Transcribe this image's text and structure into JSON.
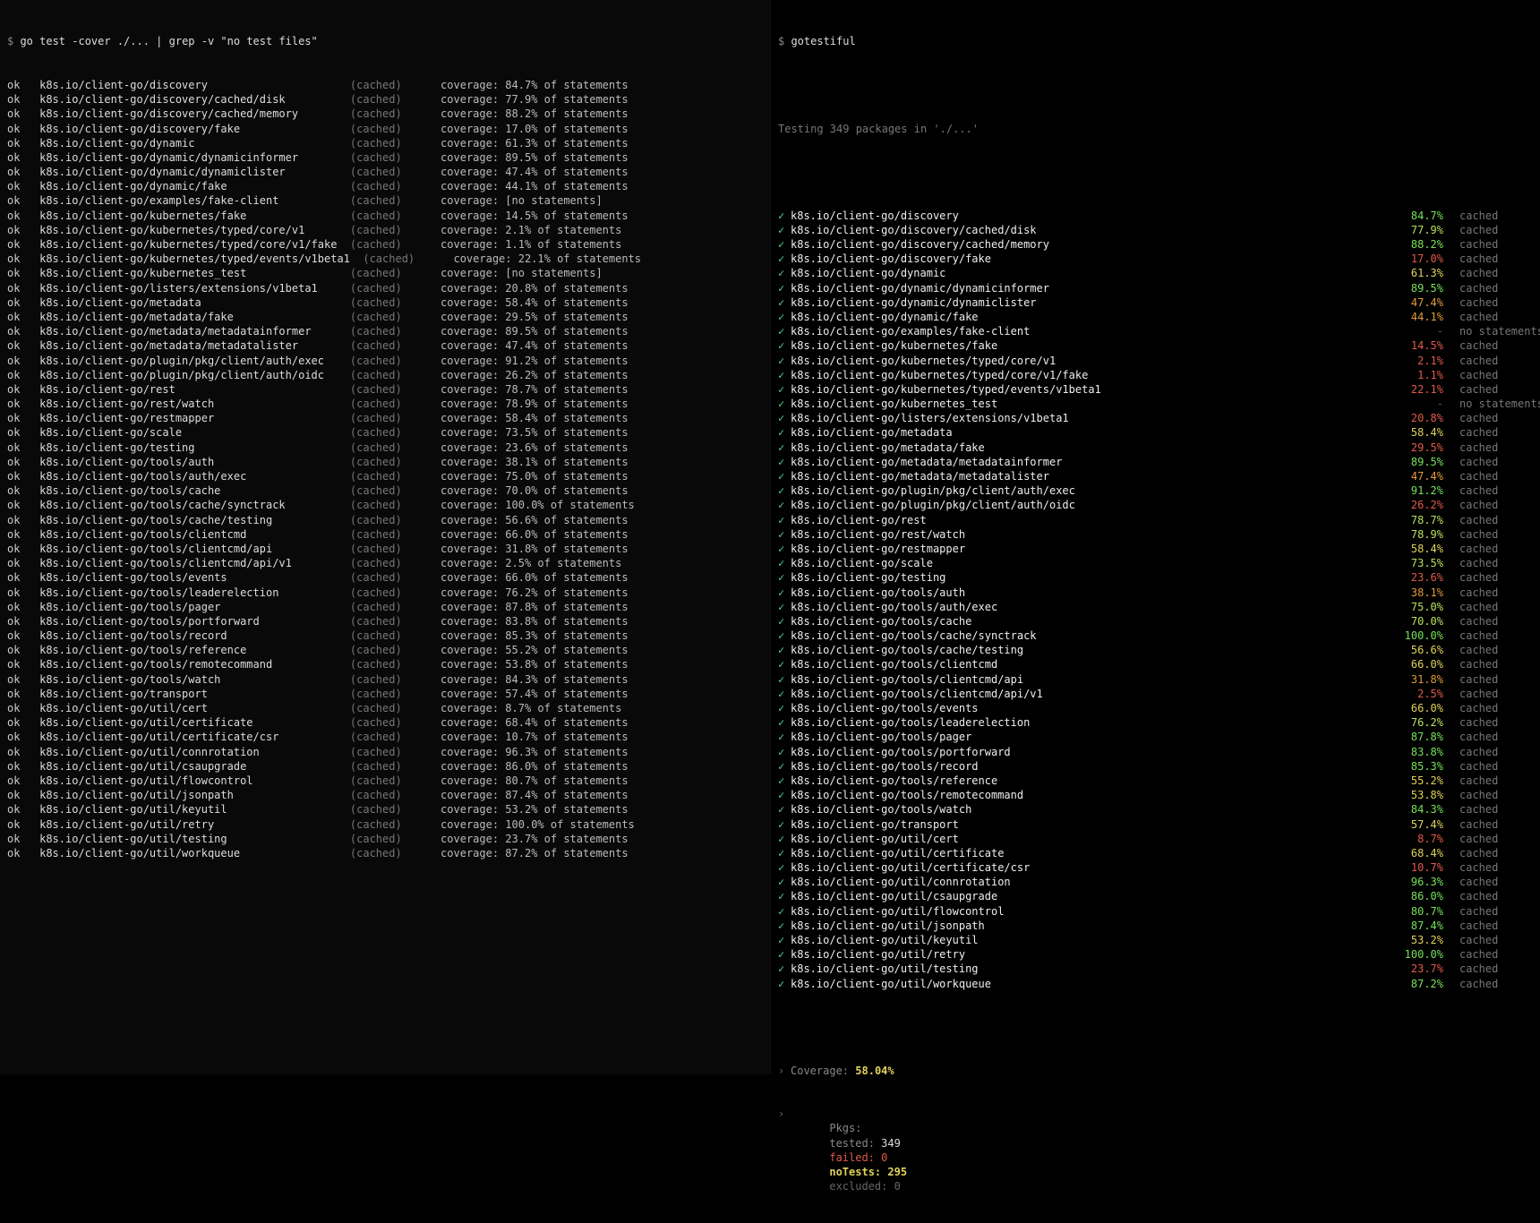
{
  "left": {
    "prompt": "$ ",
    "command": "go test -cover ./... | grep -v \"no test files\"",
    "rows": [
      {
        "pkg": "k8s.io/client-go/discovery",
        "cached": true,
        "cov": "84.7% of statements"
      },
      {
        "pkg": "k8s.io/client-go/discovery/cached/disk",
        "cached": true,
        "cov": "77.9% of statements"
      },
      {
        "pkg": "k8s.io/client-go/discovery/cached/memory",
        "cached": true,
        "cov": "88.2% of statements"
      },
      {
        "pkg": "k8s.io/client-go/discovery/fake",
        "cached": true,
        "cov": "17.0% of statements"
      },
      {
        "pkg": "k8s.io/client-go/dynamic",
        "cached": true,
        "cov": "61.3% of statements"
      },
      {
        "pkg": "k8s.io/client-go/dynamic/dynamicinformer",
        "cached": true,
        "cov": "89.5% of statements"
      },
      {
        "pkg": "k8s.io/client-go/dynamic/dynamiclister",
        "cached": true,
        "cov": "47.4% of statements"
      },
      {
        "pkg": "k8s.io/client-go/dynamic/fake",
        "cached": true,
        "cov": "44.1% of statements"
      },
      {
        "pkg": "k8s.io/client-go/examples/fake-client",
        "cached": true,
        "cov": "[no statements]"
      },
      {
        "pkg": "k8s.io/client-go/kubernetes/fake",
        "cached": true,
        "cov": "14.5% of statements"
      },
      {
        "pkg": "k8s.io/client-go/kubernetes/typed/core/v1",
        "cached": true,
        "cov": "2.1% of statements"
      },
      {
        "pkg": "k8s.io/client-go/kubernetes/typed/core/v1/fake",
        "cached": true,
        "cov": "1.1% of statements"
      },
      {
        "pkg": "k8s.io/client-go/kubernetes/typed/events/v1beta1",
        "cached": true,
        "cov": "22.1% of statements"
      },
      {
        "pkg": "k8s.io/client-go/kubernetes_test",
        "cached": true,
        "cov": "[no statements]"
      },
      {
        "pkg": "k8s.io/client-go/listers/extensions/v1beta1",
        "cached": true,
        "cov": "20.8% of statements"
      },
      {
        "pkg": "k8s.io/client-go/metadata",
        "cached": true,
        "cov": "58.4% of statements"
      },
      {
        "pkg": "k8s.io/client-go/metadata/fake",
        "cached": true,
        "cov": "29.5% of statements"
      },
      {
        "pkg": "k8s.io/client-go/metadata/metadatainformer",
        "cached": true,
        "cov": "89.5% of statements"
      },
      {
        "pkg": "k8s.io/client-go/metadata/metadatalister",
        "cached": true,
        "cov": "47.4% of statements"
      },
      {
        "pkg": "k8s.io/client-go/plugin/pkg/client/auth/exec",
        "cached": true,
        "cov": "91.2% of statements"
      },
      {
        "pkg": "k8s.io/client-go/plugin/pkg/client/auth/oidc",
        "cached": true,
        "cov": "26.2% of statements"
      },
      {
        "pkg": "k8s.io/client-go/rest",
        "cached": true,
        "cov": "78.7% of statements"
      },
      {
        "pkg": "k8s.io/client-go/rest/watch",
        "cached": true,
        "cov": "78.9% of statements"
      },
      {
        "pkg": "k8s.io/client-go/restmapper",
        "cached": true,
        "cov": "58.4% of statements"
      },
      {
        "pkg": "k8s.io/client-go/scale",
        "cached": true,
        "cov": "73.5% of statements"
      },
      {
        "pkg": "k8s.io/client-go/testing",
        "cached": true,
        "cov": "23.6% of statements"
      },
      {
        "pkg": "k8s.io/client-go/tools/auth",
        "cached": true,
        "cov": "38.1% of statements"
      },
      {
        "pkg": "k8s.io/client-go/tools/auth/exec",
        "cached": true,
        "cov": "75.0% of statements"
      },
      {
        "pkg": "k8s.io/client-go/tools/cache",
        "cached": true,
        "cov": "70.0% of statements"
      },
      {
        "pkg": "k8s.io/client-go/tools/cache/synctrack",
        "cached": true,
        "cov": "100.0% of statements"
      },
      {
        "pkg": "k8s.io/client-go/tools/cache/testing",
        "cached": true,
        "cov": "56.6% of statements"
      },
      {
        "pkg": "k8s.io/client-go/tools/clientcmd",
        "cached": true,
        "cov": "66.0% of statements"
      },
      {
        "pkg": "k8s.io/client-go/tools/clientcmd/api",
        "cached": true,
        "cov": "31.8% of statements"
      },
      {
        "pkg": "k8s.io/client-go/tools/clientcmd/api/v1",
        "cached": true,
        "cov": "2.5% of statements"
      },
      {
        "pkg": "k8s.io/client-go/tools/events",
        "cached": true,
        "cov": "66.0% of statements"
      },
      {
        "pkg": "k8s.io/client-go/tools/leaderelection",
        "cached": true,
        "cov": "76.2% of statements"
      },
      {
        "pkg": "k8s.io/client-go/tools/pager",
        "cached": true,
        "cov": "87.8% of statements"
      },
      {
        "pkg": "k8s.io/client-go/tools/portforward",
        "cached": true,
        "cov": "83.8% of statements"
      },
      {
        "pkg": "k8s.io/client-go/tools/record",
        "cached": true,
        "cov": "85.3% of statements"
      },
      {
        "pkg": "k8s.io/client-go/tools/reference",
        "cached": true,
        "cov": "55.2% of statements"
      },
      {
        "pkg": "k8s.io/client-go/tools/remotecommand",
        "cached": true,
        "cov": "53.8% of statements"
      },
      {
        "pkg": "k8s.io/client-go/tools/watch",
        "cached": true,
        "cov": "84.3% of statements"
      },
      {
        "pkg": "k8s.io/client-go/transport",
        "cached": true,
        "cov": "57.4% of statements"
      },
      {
        "pkg": "k8s.io/client-go/util/cert",
        "cached": true,
        "cov": "8.7% of statements"
      },
      {
        "pkg": "k8s.io/client-go/util/certificate",
        "cached": true,
        "cov": "68.4% of statements"
      },
      {
        "pkg": "k8s.io/client-go/util/certificate/csr",
        "cached": true,
        "cov": "10.7% of statements"
      },
      {
        "pkg": "k8s.io/client-go/util/connrotation",
        "cached": true,
        "cov": "96.3% of statements"
      },
      {
        "pkg": "k8s.io/client-go/util/csaupgrade",
        "cached": true,
        "cov": "86.0% of statements"
      },
      {
        "pkg": "k8s.io/client-go/util/flowcontrol",
        "cached": true,
        "cov": "80.7% of statements"
      },
      {
        "pkg": "k8s.io/client-go/util/jsonpath",
        "cached": true,
        "cov": "87.4% of statements"
      },
      {
        "pkg": "k8s.io/client-go/util/keyutil",
        "cached": true,
        "cov": "53.2% of statements"
      },
      {
        "pkg": "k8s.io/client-go/util/retry",
        "cached": true,
        "cov": "100.0% of statements"
      },
      {
        "pkg": "k8s.io/client-go/util/testing",
        "cached": true,
        "cov": "23.7% of statements"
      },
      {
        "pkg": "k8s.io/client-go/util/workqueue",
        "cached": true,
        "cov": "87.2% of statements"
      }
    ]
  },
  "right": {
    "prompt": "$ ",
    "command": "gotestiful",
    "subtitle": "Testing 349 packages in './...'",
    "rows": [
      {
        "pkg": "k8s.io/client-go/discovery",
        "cov": "84.7%",
        "class": "c-green",
        "status": "cached"
      },
      {
        "pkg": "k8s.io/client-go/discovery/cached/disk",
        "cov": "77.9%",
        "class": "c-lime",
        "status": "cached"
      },
      {
        "pkg": "k8s.io/client-go/discovery/cached/memory",
        "cov": "88.2%",
        "class": "c-green",
        "status": "cached"
      },
      {
        "pkg": "k8s.io/client-go/discovery/fake",
        "cov": "17.0%",
        "class": "c-red",
        "status": "cached"
      },
      {
        "pkg": "k8s.io/client-go/dynamic",
        "cov": "61.3%",
        "class": "c-yellow",
        "status": "cached"
      },
      {
        "pkg": "k8s.io/client-go/dynamic/dynamicinformer",
        "cov": "89.5%",
        "class": "c-green",
        "status": "cached"
      },
      {
        "pkg": "k8s.io/client-go/dynamic/dynamiclister",
        "cov": "47.4%",
        "class": "c-orange",
        "status": "cached"
      },
      {
        "pkg": "k8s.io/client-go/dynamic/fake",
        "cov": "44.1%",
        "class": "c-orange",
        "status": "cached"
      },
      {
        "pkg": "k8s.io/client-go/examples/fake-client",
        "cov": "-",
        "class": "c-dash",
        "status": "no statements"
      },
      {
        "pkg": "k8s.io/client-go/kubernetes/fake",
        "cov": "14.5%",
        "class": "c-red",
        "status": "cached"
      },
      {
        "pkg": "k8s.io/client-go/kubernetes/typed/core/v1",
        "cov": "2.1%",
        "class": "c-red",
        "status": "cached"
      },
      {
        "pkg": "k8s.io/client-go/kubernetes/typed/core/v1/fake",
        "cov": "1.1%",
        "class": "c-red",
        "status": "cached"
      },
      {
        "pkg": "k8s.io/client-go/kubernetes/typed/events/v1beta1",
        "cov": "22.1%",
        "class": "c-red",
        "status": "cached"
      },
      {
        "pkg": "k8s.io/client-go/kubernetes_test",
        "cov": "-",
        "class": "c-dash",
        "status": "no statements"
      },
      {
        "pkg": "k8s.io/client-go/listers/extensions/v1beta1",
        "cov": "20.8%",
        "class": "c-red",
        "status": "cached"
      },
      {
        "pkg": "k8s.io/client-go/metadata",
        "cov": "58.4%",
        "class": "c-yellow",
        "status": "cached"
      },
      {
        "pkg": "k8s.io/client-go/metadata/fake",
        "cov": "29.5%",
        "class": "c-red",
        "status": "cached"
      },
      {
        "pkg": "k8s.io/client-go/metadata/metadatainformer",
        "cov": "89.5%",
        "class": "c-green",
        "status": "cached"
      },
      {
        "pkg": "k8s.io/client-go/metadata/metadatalister",
        "cov": "47.4%",
        "class": "c-orange",
        "status": "cached"
      },
      {
        "pkg": "k8s.io/client-go/plugin/pkg/client/auth/exec",
        "cov": "91.2%",
        "class": "c-green",
        "status": "cached"
      },
      {
        "pkg": "k8s.io/client-go/plugin/pkg/client/auth/oidc",
        "cov": "26.2%",
        "class": "c-red",
        "status": "cached"
      },
      {
        "pkg": "k8s.io/client-go/rest",
        "cov": "78.7%",
        "class": "c-lime",
        "status": "cached"
      },
      {
        "pkg": "k8s.io/client-go/rest/watch",
        "cov": "78.9%",
        "class": "c-lime",
        "status": "cached"
      },
      {
        "pkg": "k8s.io/client-go/restmapper",
        "cov": "58.4%",
        "class": "c-yellow",
        "status": "cached"
      },
      {
        "pkg": "k8s.io/client-go/scale",
        "cov": "73.5%",
        "class": "c-lime",
        "status": "cached"
      },
      {
        "pkg": "k8s.io/client-go/testing",
        "cov": "23.6%",
        "class": "c-red",
        "status": "cached"
      },
      {
        "pkg": "k8s.io/client-go/tools/auth",
        "cov": "38.1%",
        "class": "c-orange",
        "status": "cached"
      },
      {
        "pkg": "k8s.io/client-go/tools/auth/exec",
        "cov": "75.0%",
        "class": "c-lime",
        "status": "cached"
      },
      {
        "pkg": "k8s.io/client-go/tools/cache",
        "cov": "70.0%",
        "class": "c-lime",
        "status": "cached"
      },
      {
        "pkg": "k8s.io/client-go/tools/cache/synctrack",
        "cov": "100.0%",
        "class": "c-green",
        "status": "cached"
      },
      {
        "pkg": "k8s.io/client-go/tools/cache/testing",
        "cov": "56.6%",
        "class": "c-yellow",
        "status": "cached"
      },
      {
        "pkg": "k8s.io/client-go/tools/clientcmd",
        "cov": "66.0%",
        "class": "c-yellow",
        "status": "cached"
      },
      {
        "pkg": "k8s.io/client-go/tools/clientcmd/api",
        "cov": "31.8%",
        "class": "c-orange",
        "status": "cached"
      },
      {
        "pkg": "k8s.io/client-go/tools/clientcmd/api/v1",
        "cov": "2.5%",
        "class": "c-red",
        "status": "cached"
      },
      {
        "pkg": "k8s.io/client-go/tools/events",
        "cov": "66.0%",
        "class": "c-yellow",
        "status": "cached"
      },
      {
        "pkg": "k8s.io/client-go/tools/leaderelection",
        "cov": "76.2%",
        "class": "c-lime",
        "status": "cached"
      },
      {
        "pkg": "k8s.io/client-go/tools/pager",
        "cov": "87.8%",
        "class": "c-green",
        "status": "cached"
      },
      {
        "pkg": "k8s.io/client-go/tools/portforward",
        "cov": "83.8%",
        "class": "c-green",
        "status": "cached"
      },
      {
        "pkg": "k8s.io/client-go/tools/record",
        "cov": "85.3%",
        "class": "c-green",
        "status": "cached"
      },
      {
        "pkg": "k8s.io/client-go/tools/reference",
        "cov": "55.2%",
        "class": "c-yellow",
        "status": "cached"
      },
      {
        "pkg": "k8s.io/client-go/tools/remotecommand",
        "cov": "53.8%",
        "class": "c-yellow",
        "status": "cached"
      },
      {
        "pkg": "k8s.io/client-go/tools/watch",
        "cov": "84.3%",
        "class": "c-green",
        "status": "cached"
      },
      {
        "pkg": "k8s.io/client-go/transport",
        "cov": "57.4%",
        "class": "c-yellow",
        "status": "cached"
      },
      {
        "pkg": "k8s.io/client-go/util/cert",
        "cov": "8.7%",
        "class": "c-red",
        "status": "cached"
      },
      {
        "pkg": "k8s.io/client-go/util/certificate",
        "cov": "68.4%",
        "class": "c-yellow",
        "status": "cached"
      },
      {
        "pkg": "k8s.io/client-go/util/certificate/csr",
        "cov": "10.7%",
        "class": "c-red",
        "status": "cached"
      },
      {
        "pkg": "k8s.io/client-go/util/connrotation",
        "cov": "96.3%",
        "class": "c-green",
        "status": "cached"
      },
      {
        "pkg": "k8s.io/client-go/util/csaupgrade",
        "cov": "86.0%",
        "class": "c-green",
        "status": "cached"
      },
      {
        "pkg": "k8s.io/client-go/util/flowcontrol",
        "cov": "80.7%",
        "class": "c-green",
        "status": "cached"
      },
      {
        "pkg": "k8s.io/client-go/util/jsonpath",
        "cov": "87.4%",
        "class": "c-green",
        "status": "cached"
      },
      {
        "pkg": "k8s.io/client-go/util/keyutil",
        "cov": "53.2%",
        "class": "c-yellow",
        "status": "cached"
      },
      {
        "pkg": "k8s.io/client-go/util/retry",
        "cov": "100.0%",
        "class": "c-green",
        "status": "cached"
      },
      {
        "pkg": "k8s.io/client-go/util/testing",
        "cov": "23.7%",
        "class": "c-red",
        "status": "cached"
      },
      {
        "pkg": "k8s.io/client-go/util/workqueue",
        "cov": "87.2%",
        "class": "c-green",
        "status": "cached"
      }
    ],
    "summary": {
      "coverage_label": "Coverage:",
      "coverage_value": "58.04%",
      "pkgs_label": "Pkgs:",
      "tested_label": "tested:",
      "tested_value": "349",
      "failed_label": "failed:",
      "failed_value": "0",
      "notests_label": "noTests:",
      "notests_value": "295",
      "excluded_label": "excluded:",
      "excluded_value": "0"
    }
  }
}
